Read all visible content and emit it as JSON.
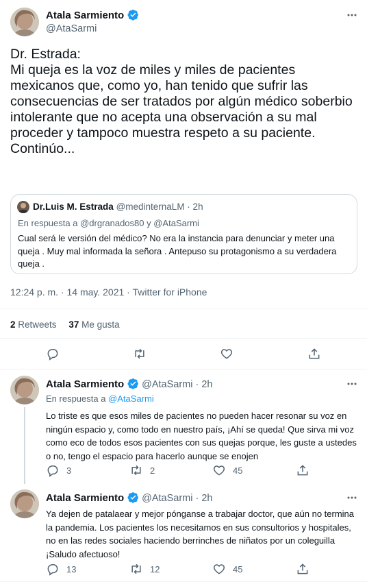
{
  "main_tweet": {
    "author_name": "Atala Sarmiento",
    "author_handle": "@AtaSarmi",
    "text": "Dr. Estrada:\nMi queja es la voz de miles y miles de pacientes mexicanos que, como yo, han tenido que sufrir las consecuencias de ser tratados por algún médico soberbio intolerante que no acepta una observación a su mal proceder y tampoco muestra respeto a su paciente.\nContinúo...",
    "timestamp": "12:24 p. m. · 14 may. 2021 · ",
    "source": "Twitter for iPhone",
    "retweets_count": "2",
    "retweets_label": "Retweets",
    "likes_count": "37",
    "likes_label": "Me gusta"
  },
  "quoted_tweet": {
    "author_name": "Dr.Luis M. Estrada",
    "author_handle": "@medinternaLM · 2h",
    "reply_prefix": "En respuesta a ",
    "reply_to": "@drgranados80 y @AtaSarmi",
    "text": "Cual será le versión del médico? No era la instancia para denunciar y meter una queja . Muy mal informada la señora . Antepuso su protagonismo a su verdadera queja ."
  },
  "replies": [
    {
      "author_name": "Atala Sarmiento",
      "author_handle": "@AtaSarmi · 2h",
      "reply_prefix": "En respuesta a ",
      "reply_to": "@AtaSarmi",
      "text": "Lo triste es que esos miles de pacientes no pueden hacer resonar su voz en ningún espacio y, como todo en nuestro país, ¡Ahí se queda! Que sirva mi voz como eco de todos esos pacientes con sus quejas porque, les guste a ustedes o no, tengo el espacio para hacerlo aunque se enojen",
      "replies": "3",
      "retweets": "2",
      "likes": "45"
    },
    {
      "author_name": "Atala Sarmiento",
      "author_handle": "@AtaSarmi · 2h",
      "text": "Ya dejen de patalaear y mejor pónganse a trabajar doctor, que aún no termina la pandemia. Los pacientes los necesitamos en sus consultorios y hospitales, no en las redes sociales haciendo berrinches de niñatos por un coleguilla ¡Saludo afectuoso!",
      "replies": "13",
      "retweets": "12",
      "likes": "45"
    }
  ],
  "colors": {
    "accent": "#1d9bf0",
    "muted": "#536471",
    "divider": "#eff3f4"
  }
}
